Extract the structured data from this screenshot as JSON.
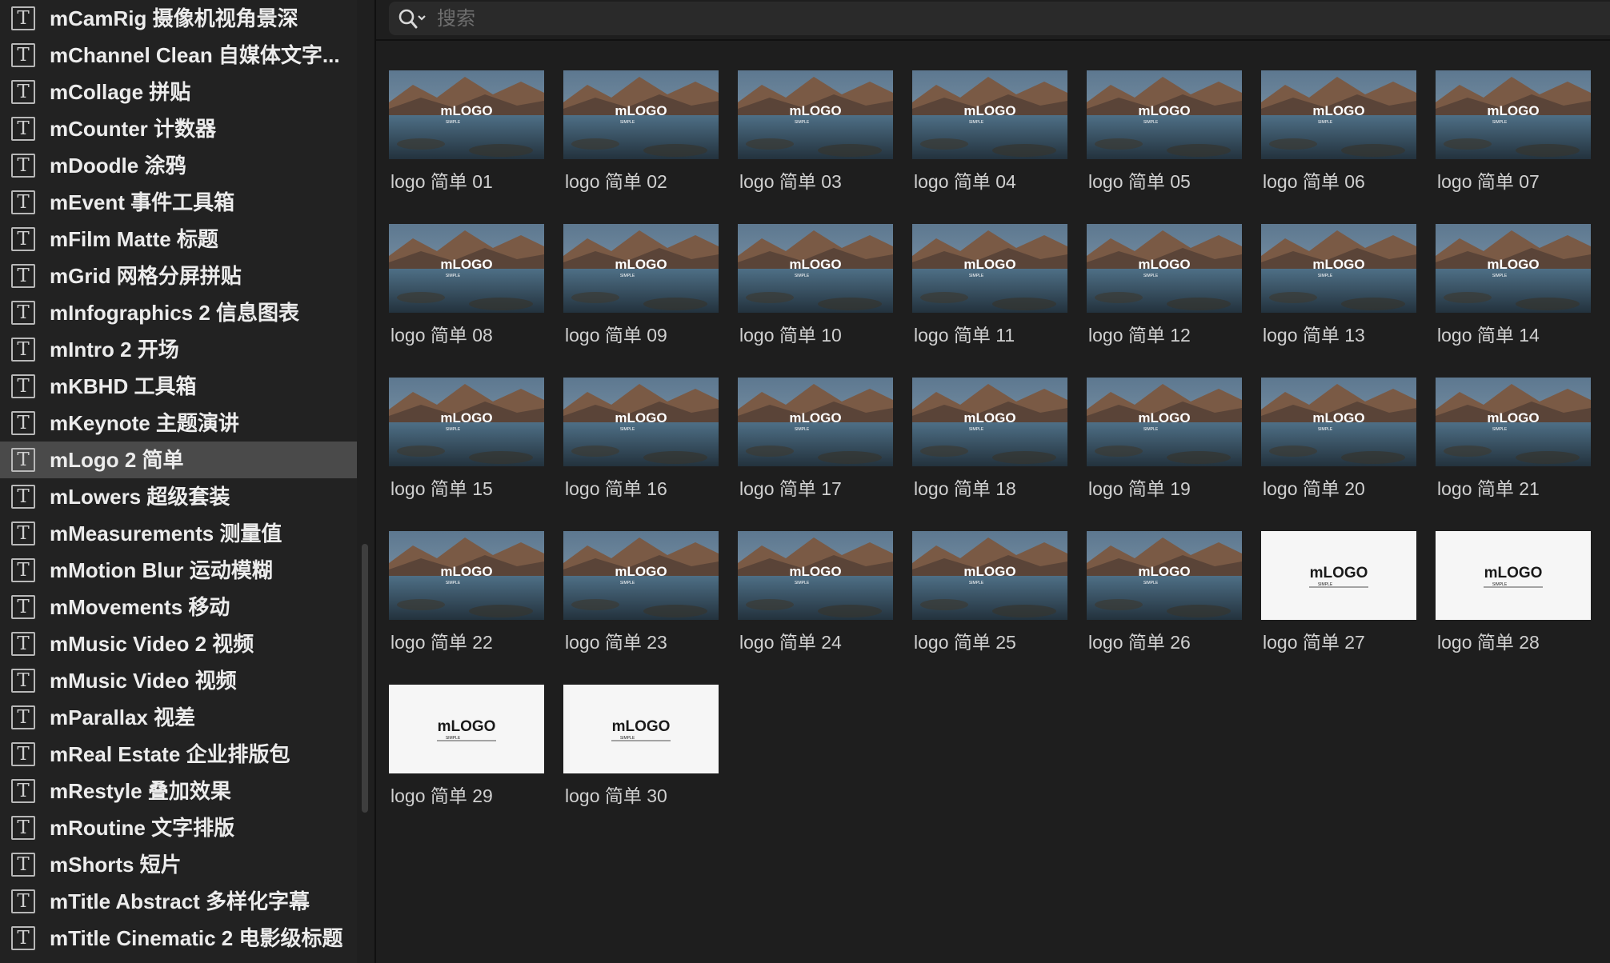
{
  "sidebar": {
    "items": [
      {
        "label": "mCamRig 摄像机视角景深"
      },
      {
        "label": "mChannel Clean 自媒体文字..."
      },
      {
        "label": "mCollage 拼贴"
      },
      {
        "label": "mCounter 计数器"
      },
      {
        "label": "mDoodle 涂鸦"
      },
      {
        "label": "mEvent 事件工具箱"
      },
      {
        "label": "mFilm Matte 标题"
      },
      {
        "label": "mGrid 网格分屏拼贴"
      },
      {
        "label": "mInfographics 2 信息图表"
      },
      {
        "label": "mIntro 2 开场"
      },
      {
        "label": "mKBHD 工具箱"
      },
      {
        "label": "mKeynote 主题演讲"
      },
      {
        "label": "mLogo 2 简单"
      },
      {
        "label": "mLowers 超级套装"
      },
      {
        "label": "mMeasurements 测量值"
      },
      {
        "label": "mMotion Blur 运动模糊"
      },
      {
        "label": "mMovements 移动"
      },
      {
        "label": "mMusic Video 2 视频"
      },
      {
        "label": "mMusic Video 视频"
      },
      {
        "label": "mParallax 视差"
      },
      {
        "label": "mReal Estate 企业排版包"
      },
      {
        "label": "mRestyle 叠加效果"
      },
      {
        "label": "mRoutine 文字排版"
      },
      {
        "label": "mShorts 短片"
      },
      {
        "label": "mTitle Abstract 多样化字幕"
      },
      {
        "label": "mTitle Cinematic 2 电影级标题"
      }
    ],
    "selected_label": "mLogo 2 简单",
    "item_icon": "text-T-icon"
  },
  "search": {
    "placeholder": "搜索",
    "icon": "search-icon"
  },
  "thumbnail_text": {
    "logo": "mLOGO",
    "tagline": "SIMPLE"
  },
  "templates": [
    {
      "label": "logo 简单 01",
      "style": "landscape"
    },
    {
      "label": "logo 简单 02",
      "style": "landscape"
    },
    {
      "label": "logo 简单 03",
      "style": "landscape"
    },
    {
      "label": "logo 简单 04",
      "style": "landscape"
    },
    {
      "label": "logo 简单 05",
      "style": "landscape"
    },
    {
      "label": "logo 简单 06",
      "style": "landscape"
    },
    {
      "label": "logo 简单 07",
      "style": "landscape"
    },
    {
      "label": "logo 简单 08",
      "style": "landscape"
    },
    {
      "label": "logo 简单 09",
      "style": "landscape"
    },
    {
      "label": "logo 简单 10",
      "style": "landscape"
    },
    {
      "label": "logo 简单 11",
      "style": "landscape"
    },
    {
      "label": "logo 简单 12",
      "style": "landscape"
    },
    {
      "label": "logo 简单 13",
      "style": "landscape"
    },
    {
      "label": "logo 简单 14",
      "style": "landscape"
    },
    {
      "label": "logo 简单 15",
      "style": "landscape"
    },
    {
      "label": "logo 简单 16",
      "style": "landscape"
    },
    {
      "label": "logo 简单 17",
      "style": "landscape"
    },
    {
      "label": "logo 简单 18",
      "style": "landscape"
    },
    {
      "label": "logo 简单 19",
      "style": "landscape"
    },
    {
      "label": "logo 简单 20",
      "style": "landscape"
    },
    {
      "label": "logo 简单 21",
      "style": "landscape"
    },
    {
      "label": "logo 简单 22",
      "style": "landscape"
    },
    {
      "label": "logo 简单 23",
      "style": "landscape"
    },
    {
      "label": "logo 简单 24",
      "style": "landscape"
    },
    {
      "label": "logo 简单 25",
      "style": "landscape"
    },
    {
      "label": "logo 简单 26",
      "style": "landscape"
    },
    {
      "label": "logo 简单 27",
      "style": "white"
    },
    {
      "label": "logo 简单 28",
      "style": "white"
    },
    {
      "label": "logo 简单 29",
      "style": "white"
    },
    {
      "label": "logo 简单 30",
      "style": "white"
    }
  ],
  "colors": {
    "sidebar_bg": "#222222",
    "selected_bg": "#4a4a4a",
    "main_bg": "#1e1e1e",
    "text": "#ececec"
  }
}
